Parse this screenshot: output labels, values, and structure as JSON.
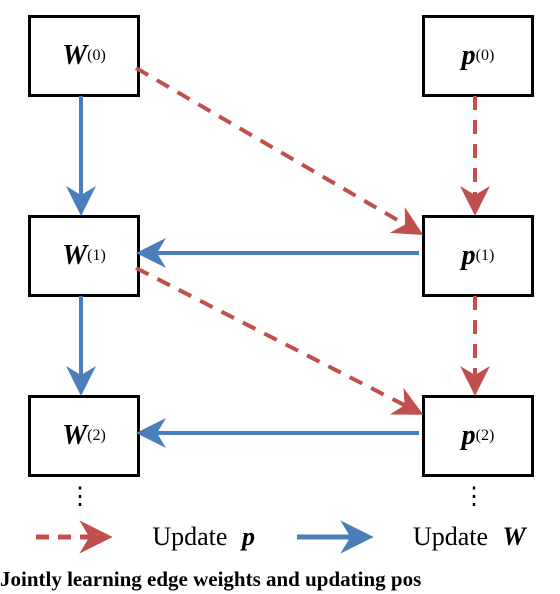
{
  "nodes": {
    "W0": {
      "html": "<span class='bigW'>W</span><sup>(0)</sup>"
    },
    "W1": {
      "html": "<span class='bigW'>W</span><sup>(1)</sup>"
    },
    "W2": {
      "html": "<span class='bigW'>W</span><sup>(2)</sup>"
    },
    "p0": {
      "html": "<span class='bigp'>p</span><sup>(0)</sup>"
    },
    "p1": {
      "html": "<span class='bigp'>p</span><sup>(1)</sup>"
    },
    "p2": {
      "html": "<span class='bigp'>p</span><sup>(2)</sup>"
    }
  },
  "ellipsis_left": "⋮",
  "ellipsis_right": "⋮",
  "legend": {
    "update_p": "Update",
    "update_p_sym": "p",
    "update_W": "Update",
    "update_W_sym": "W"
  },
  "arrows": {
    "solid_color": "#4a7ebb",
    "dashed_color": "#c0504d"
  },
  "caption": "Jointly learning edge weights and updating pos",
  "chart_data": {
    "type": "diagram",
    "description": "Two columns of variable boxes with dependency arrows showing alternating updates of W and p across iterations.",
    "columns": {
      "W": [
        "W(0)",
        "W(1)",
        "W(2)",
        "…"
      ],
      "p": [
        "p(0)",
        "p(1)",
        "p(2)",
        "…"
      ]
    },
    "edges_dashed_red_update_p": [
      {
        "from": "W(0)",
        "to": "p(1)"
      },
      {
        "from": "p(0)",
        "to": "p(1)"
      },
      {
        "from": "W(1)",
        "to": "p(2)"
      },
      {
        "from": "p(1)",
        "to": "p(2)"
      }
    ],
    "edges_solid_blue_update_W": [
      {
        "from": "W(0)",
        "to": "W(1)"
      },
      {
        "from": "p(1)",
        "to": "W(1)"
      },
      {
        "from": "W(1)",
        "to": "W(2)"
      },
      {
        "from": "p(2)",
        "to": "W(2)"
      }
    ],
    "legend": [
      {
        "style": "dashed-red",
        "label": "Update p"
      },
      {
        "style": "solid-blue",
        "label": "Update W"
      }
    ],
    "caption_visible_prefix": "Jointly learning edge weights and updating pos"
  }
}
